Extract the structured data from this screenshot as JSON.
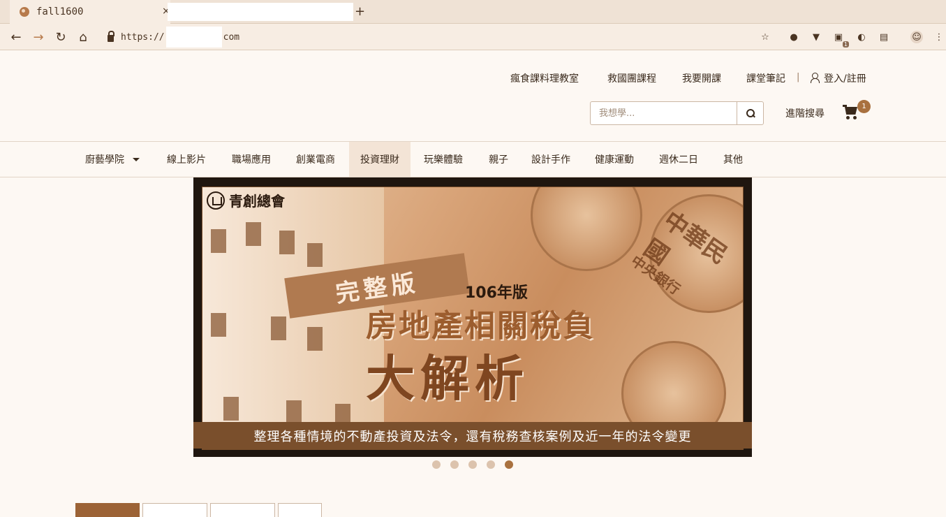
{
  "browser": {
    "active_tab_title": "fall1600",
    "url_prefix": "https://",
    "url_suffix": "com",
    "extension_badge": "1"
  },
  "header": {
    "links": [
      "瘋食課料理教室",
      "救國團課程",
      "我要開課",
      "課堂筆記"
    ],
    "separator": "|",
    "login_label": "登入/註冊",
    "search_placeholder": "我想學...",
    "advanced_search_label": "進階搜尋",
    "cart_count": "1"
  },
  "main_nav": {
    "items": [
      "廚藝學院",
      "線上影片",
      "職場應用",
      "創業電商",
      "投資理財",
      "玩樂體驗",
      "親子",
      "設計手作",
      "健康運動",
      "週休二日",
      "其他"
    ],
    "active_index": 4
  },
  "banner": {
    "brand": "青創總會",
    "ribbon": "完整版",
    "edition": "106年版",
    "headline_line1": "房地產相關稅負",
    "headline_line2": "大解析",
    "note_text_1": "中華民國",
    "note_text_2": "中央銀行",
    "caption": "整理各種情境的不動產投資及法令，還有稅務查核案例及近一年的法令變更",
    "slide_count": 5,
    "active_slide": 5
  },
  "colors": {
    "accent": "#a9713f",
    "page_bg": "#fdf8f3",
    "nav_active_bg": "#f3e4d6"
  }
}
